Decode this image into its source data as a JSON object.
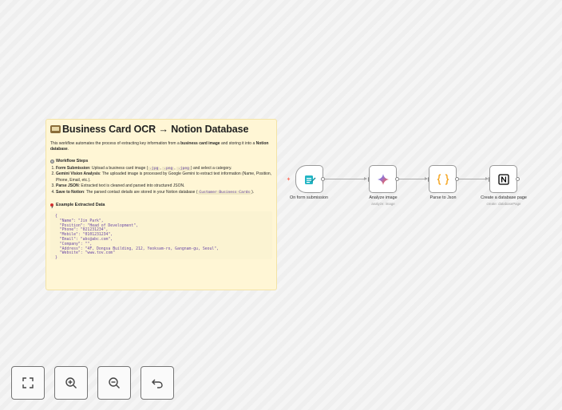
{
  "sticky": {
    "title": "Business Card OCR → Notion Database",
    "intro_pre": "This workflow automates the process of extracting key information from a ",
    "intro_bold1": "business card image",
    "intro_mid": " and storing it into a ",
    "intro_bold2": "Notion database",
    "intro_end": ".",
    "steps_heading": "Workflow Steps",
    "steps": [
      {
        "bold": "Form Submission",
        "pre": ": Upload a business card image (",
        "codes": [
          ".jpg",
          ".png",
          ".jpeg"
        ],
        "post": ") and select a category."
      },
      {
        "bold": "Gemini Vision Analysis",
        "text": ": The uploaded image is processed by Google Gemini to extract text information (Name, Position, Phone, Email, etc.)."
      },
      {
        "bold": "Parse JSON",
        "text": ": Extracted text is cleaned and parsed into structured JSON."
      },
      {
        "bold": "Save to Notion",
        "pre": ": The parsed contact details are stored in your Notion database (",
        "code": "Customer Business Cards",
        "post": ")."
      }
    ],
    "example_heading": "Example Extracted Data",
    "code_lines": [
      "{",
      "  \"Name\": \"Jin Park\",",
      "  \"Position\": \"Head of Development\",",
      "  \"Phone\": \"021231234\",",
      "  \"Mobile\": \"0101231234\",",
      "  \"Email\": \"abc@abc.com\",",
      "  \"Company\": \"\",",
      "  \"Address\": \"4F, Dongsa Building, 212, Yeoksam-ro, Gangnam-gu, Seoul\",",
      "  \"Website\": \"www.tov.com\"",
      "}"
    ]
  },
  "nodes": [
    {
      "label": "On form submission",
      "sub": ""
    },
    {
      "label": "Analyze image",
      "sub": "analyze: image"
    },
    {
      "label": "Parse to Json",
      "sub": ""
    },
    {
      "label": "Create a database page",
      "sub": "create: databasePage"
    }
  ],
  "colors": {
    "trigger_bolt": "#ff6d5a",
    "form_icon": "#21b5c4",
    "code_icon": "#f5a623",
    "notion": "#000000"
  },
  "toolbar": {
    "icons": [
      "fit-view-icon",
      "zoom-in-icon",
      "zoom-out-icon",
      "reset-zoom-icon"
    ]
  }
}
